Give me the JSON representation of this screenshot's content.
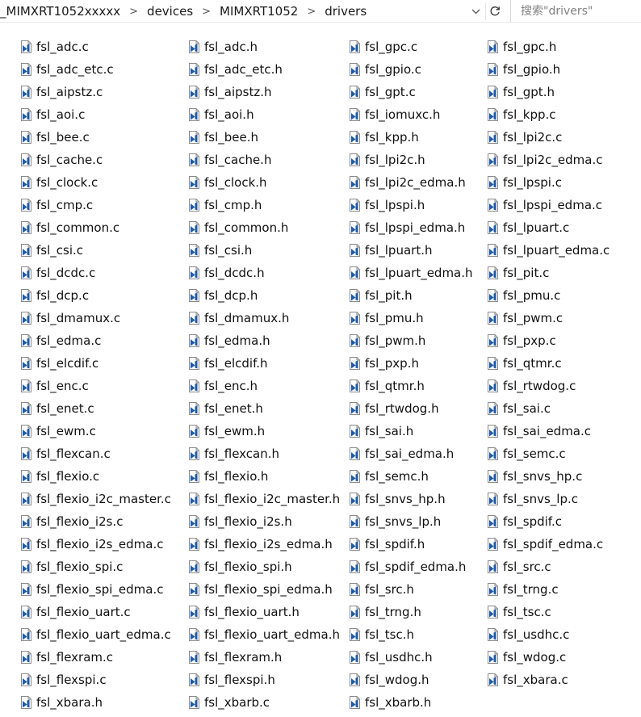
{
  "address": {
    "crumbs": [
      "_MIMXRT1052xxxxx",
      "devices",
      "MIMXRT1052",
      "drivers"
    ],
    "separator": ">"
  },
  "search": {
    "placeholder": "搜索\"drivers\""
  },
  "icons": {
    "file_icon": "source-file-icon",
    "dropdown": "chevron-down-icon",
    "refresh": "refresh-icon"
  },
  "columns": [
    {
      "files": [
        "fsl_adc.c",
        "fsl_adc_etc.c",
        "fsl_aipstz.c",
        "fsl_aoi.c",
        "fsl_bee.c",
        "fsl_cache.c",
        "fsl_clock.c",
        "fsl_cmp.c",
        "fsl_common.c",
        "fsl_csi.c",
        "fsl_dcdc.c",
        "fsl_dcp.c",
        "fsl_dmamux.c",
        "fsl_edma.c",
        "fsl_elcdif.c",
        "fsl_enc.c",
        "fsl_enet.c",
        "fsl_ewm.c",
        "fsl_flexcan.c",
        "fsl_flexio.c",
        "fsl_flexio_i2c_master.c",
        "fsl_flexio_i2s.c",
        "fsl_flexio_i2s_edma.c",
        "fsl_flexio_spi.c",
        "fsl_flexio_spi_edma.c",
        "fsl_flexio_uart.c",
        "fsl_flexio_uart_edma.c",
        "fsl_flexram.c",
        "fsl_flexspi.c",
        "fsl_xbara.h"
      ]
    },
    {
      "files": [
        "fsl_adc.h",
        "fsl_adc_etc.h",
        "fsl_aipstz.h",
        "fsl_aoi.h",
        "fsl_bee.h",
        "fsl_cache.h",
        "fsl_clock.h",
        "fsl_cmp.h",
        "fsl_common.h",
        "fsl_csi.h",
        "fsl_dcdc.h",
        "fsl_dcp.h",
        "fsl_dmamux.h",
        "fsl_edma.h",
        "fsl_elcdif.h",
        "fsl_enc.h",
        "fsl_enet.h",
        "fsl_ewm.h",
        "fsl_flexcan.h",
        "fsl_flexio.h",
        "fsl_flexio_i2c_master.h",
        "fsl_flexio_i2s.h",
        "fsl_flexio_i2s_edma.h",
        "fsl_flexio_spi.h",
        "fsl_flexio_spi_edma.h",
        "fsl_flexio_uart.h",
        "fsl_flexio_uart_edma.h",
        "fsl_flexram.h",
        "fsl_flexspi.h",
        "fsl_xbarb.c"
      ]
    },
    {
      "files": [
        "fsl_gpc.c",
        "fsl_gpio.c",
        "fsl_gpt.c",
        "fsl_iomuxc.h",
        "fsl_kpp.h",
        "fsl_lpi2c.h",
        "fsl_lpi2c_edma.h",
        "fsl_lpspi.h",
        "fsl_lpspi_edma.h",
        "fsl_lpuart.h",
        "fsl_lpuart_edma.h",
        "fsl_pit.h",
        "fsl_pmu.h",
        "fsl_pwm.h",
        "fsl_pxp.h",
        "fsl_qtmr.h",
        "fsl_rtwdog.h",
        "fsl_sai.h",
        "fsl_sai_edma.h",
        "fsl_semc.h",
        "fsl_snvs_hp.h",
        "fsl_snvs_lp.h",
        "fsl_spdif.h",
        "fsl_spdif_edma.h",
        "fsl_src.h",
        "fsl_trng.h",
        "fsl_tsc.h",
        "fsl_usdhc.h",
        "fsl_wdog.h",
        "fsl_xbarb.h"
      ]
    },
    {
      "files": [
        "fsl_gpc.h",
        "fsl_gpio.h",
        "fsl_gpt.h",
        "fsl_kpp.c",
        "fsl_lpi2c.c",
        "fsl_lpi2c_edma.c",
        "fsl_lpspi.c",
        "fsl_lpspi_edma.c",
        "fsl_lpuart.c",
        "fsl_lpuart_edma.c",
        "fsl_pit.c",
        "fsl_pmu.c",
        "fsl_pwm.c",
        "fsl_pxp.c",
        "fsl_qtmr.c",
        "fsl_rtwdog.c",
        "fsl_sai.c",
        "fsl_sai_edma.c",
        "fsl_semc.c",
        "fsl_snvs_hp.c",
        "fsl_snvs_lp.c",
        "fsl_spdif.c",
        "fsl_spdif_edma.c",
        "fsl_src.c",
        "fsl_trng.c",
        "fsl_tsc.c",
        "fsl_usdhc.c",
        "fsl_wdog.c",
        "fsl_xbara.c"
      ]
    }
  ]
}
